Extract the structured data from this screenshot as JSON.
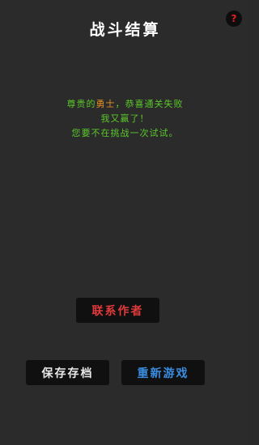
{
  "screen": {
    "title": "战斗结算",
    "help_icon": "question-mark-icon",
    "help_glyph": "?"
  },
  "message": {
    "line1_prefix": "尊贵的",
    "line1_highlight": "勇士",
    "line1_suffix": "，恭喜通关失败",
    "line2": "我又赢了！",
    "line3": "您要不在挑战一次试试。"
  },
  "buttons": {
    "contact_author": "联系作者",
    "save_game": "保存存档",
    "restart_game": "重新游戏"
  },
  "colors": {
    "background": "#2b2b2b",
    "message_text": "#5ac82a",
    "highlight_text": "#e89020",
    "contact_button_text": "#e23a3a",
    "save_button_text": "#e8e8e8",
    "restart_button_text": "#3a8de0",
    "button_background": "#101010",
    "help_icon_color": "#e02020"
  }
}
